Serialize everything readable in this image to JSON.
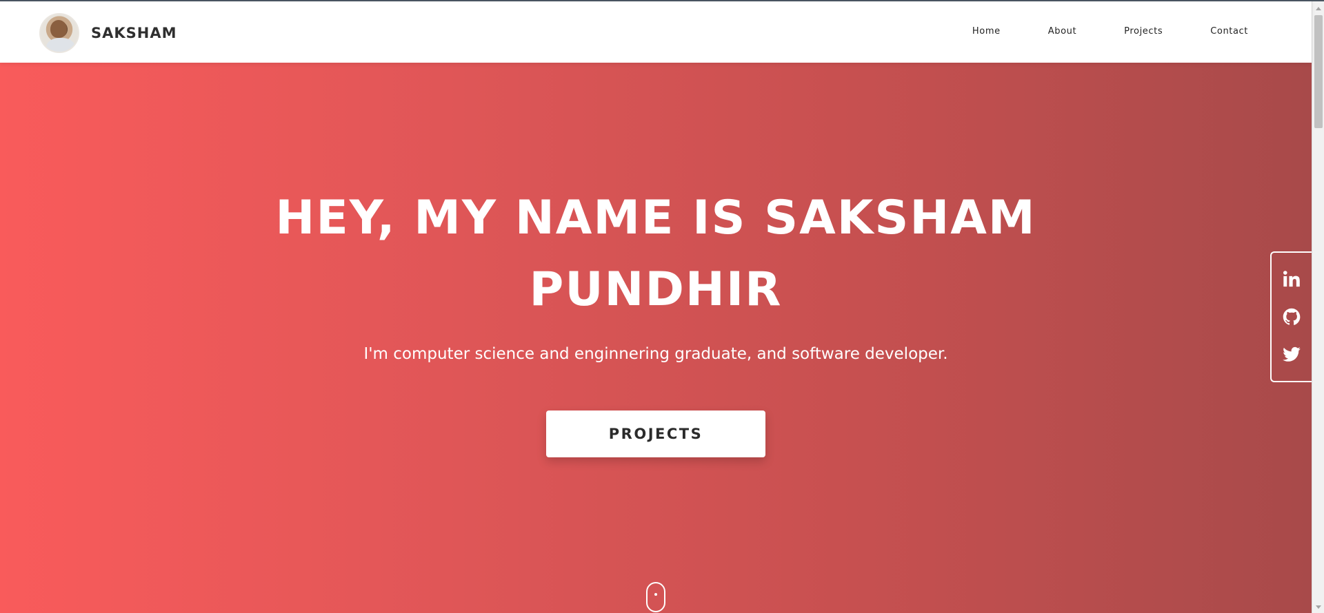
{
  "header": {
    "brand_name": "SAKSHAM",
    "nav": [
      {
        "label": "Home"
      },
      {
        "label": "About"
      },
      {
        "label": "Projects"
      },
      {
        "label": "Contact"
      }
    ]
  },
  "hero": {
    "title_line1": "HEY, MY NAME IS SAKSHAM",
    "title_line2": "PUNDHIR",
    "subtitle": "I'm computer science and enginnering graduate, and software developer.",
    "cta_label": "PROJECTS"
  },
  "social": [
    {
      "icon": "linkedin-icon"
    },
    {
      "icon": "github-icon"
    },
    {
      "icon": "twitter-icon"
    }
  ],
  "colors": {
    "hero_gradient_start": "#f95b5b",
    "hero_gradient_end": "#a84a4a",
    "text_dark": "#2f2f2f",
    "white": "#ffffff"
  }
}
